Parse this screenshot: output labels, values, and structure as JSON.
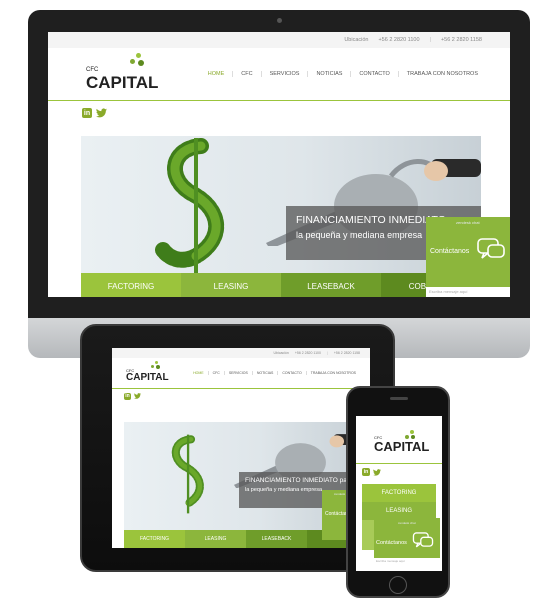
{
  "topbar": {
    "location": "Ubicación",
    "phone1": "+56 2 2820 1100",
    "sep": "|",
    "phone2": "+56 2 2820 1158"
  },
  "logo": {
    "cfc": "CFC",
    "capital": "CAPITAL"
  },
  "nav": [
    "HOME",
    "CFC",
    "SERVICIOS",
    "NOTICIAS",
    "CONTACTO",
    "TRABAJA CON NOSOTROS"
  ],
  "social": {
    "linkedin": "in"
  },
  "hero": {
    "line1": "FINANCIAMIENTO INMEDIATO para",
    "line2": "la pequeña y mediana empresa"
  },
  "tabs": [
    "FACTORING",
    "LEASING",
    "LEASEBACK",
    "COBRANZA"
  ],
  "tablet_tabs": [
    "FACTORING",
    "LEASING",
    "LEASEBACK",
    "COBR"
  ],
  "phone_tabs": [
    "FACTORING",
    "LEASING"
  ],
  "chat": {
    "brand": "zendesk chat",
    "label": "Contáctanos",
    "placeholder": "Escriba mensaje aquí"
  },
  "colors": {
    "green_light": "#9bc43c",
    "green_mid": "#7fa832",
    "green_dark": "#5d8a1f",
    "chat": "#8cb63c"
  }
}
